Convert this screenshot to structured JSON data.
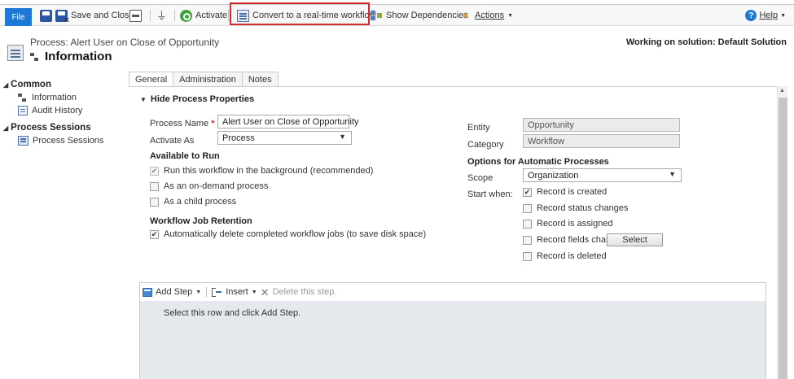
{
  "ribbon": {
    "file": "File",
    "save_close": "Save and Close",
    "activate": "Activate",
    "convert": "Convert to a real-time workflow",
    "show_dependencies": "Show Dependencies",
    "actions": "Actions",
    "help": "Help",
    "highlight_color": "#d22b2b"
  },
  "header": {
    "process_title": "Process: Alert User on Close of Opportunity",
    "section_title": "Information",
    "solution": "Working on solution: Default Solution"
  },
  "nav": {
    "common": "Common",
    "information": "Information",
    "audit_history": "Audit History",
    "process_sessions_group": "Process Sessions",
    "process_sessions": "Process Sessions"
  },
  "tabs": [
    "General",
    "Administration",
    "Notes"
  ],
  "form": {
    "section": "Hide Process Properties",
    "process_name_label": "Process Name",
    "required_mark": "*",
    "process_name": "Alert User on Close of Opportunity",
    "activate_as_label": "Activate As",
    "activate_as": "Process",
    "available_to_run": "Available to Run",
    "run_background": "Run this workflow in the background (recommended)",
    "on_demand": "As an on-demand process",
    "child_process": "As a child process",
    "job_retention": "Workflow Job Retention",
    "auto_delete": "Automatically delete completed workflow jobs (to save disk space)",
    "entity_label": "Entity",
    "entity": "Opportunity",
    "category_label": "Category",
    "category": "Workflow",
    "options_auto": "Options for Automatic Processes",
    "scope_label": "Scope",
    "scope": "Organization",
    "start_when_label": "Start when:",
    "record_created": "Record is created",
    "record_status": "Record status changes",
    "record_assigned": "Record is assigned",
    "record_fields": "Record fields change",
    "select_button": "Select",
    "record_deleted": "Record is deleted"
  },
  "steps": {
    "add_step": "Add Step",
    "insert": "Insert",
    "delete": "Delete this step.",
    "hint": "Select this row and click Add Step."
  },
  "icons": {
    "check": "✔",
    "dropdown": "▼",
    "collapse": "◢"
  }
}
